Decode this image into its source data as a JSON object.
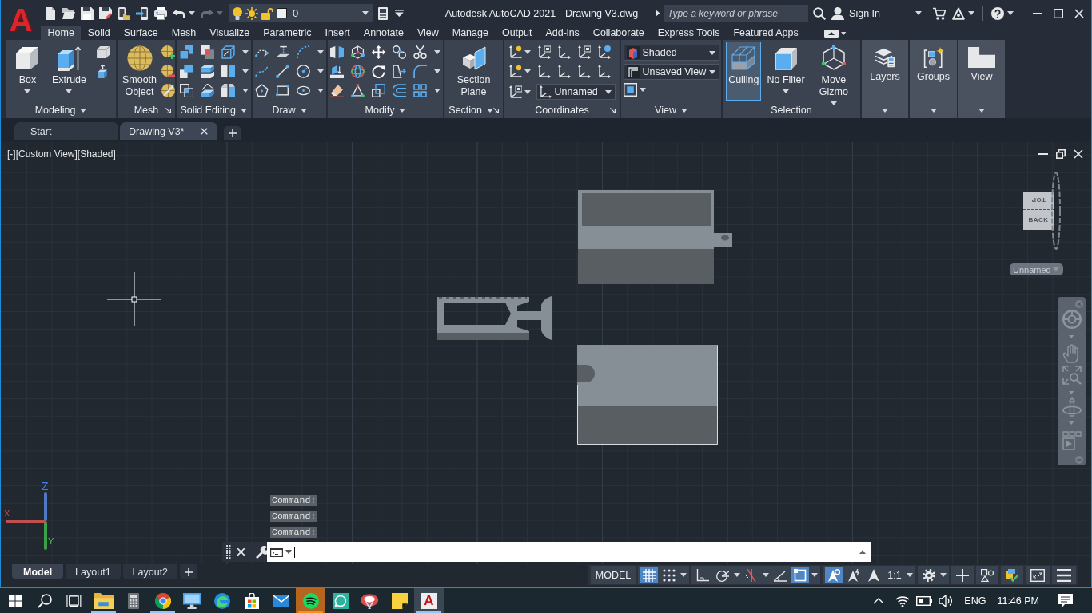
{
  "title_bar": {
    "logo": "A",
    "quick_access": [
      {
        "kind": "new",
        "disabled": false,
        "menu": false
      },
      {
        "kind": "open",
        "disabled": false,
        "menu": false
      },
      {
        "kind": "save",
        "disabled": false,
        "menu": false
      },
      {
        "kind": "save-as",
        "disabled": false,
        "menu": false
      },
      {
        "kind": "open-mobile",
        "disabled": false,
        "menu": false
      },
      {
        "kind": "share-mobile",
        "disabled": false,
        "menu": false
      },
      {
        "kind": "plot",
        "disabled": false,
        "menu": false
      },
      {
        "kind": "undo",
        "disabled": false,
        "menu": true
      },
      {
        "kind": "redo",
        "disabled": true,
        "menu": true
      }
    ],
    "layer": {
      "on": true,
      "frozen": false,
      "locked": false,
      "value": "0"
    },
    "app_title": "Autodesk AutoCAD 2021",
    "file_name": "Drawing V3.dwg",
    "search": {
      "placeholder": "Type a keyword or phrase"
    },
    "sign_in": "Sign In"
  },
  "ribbon": {
    "tabs": [
      {
        "label": "Home",
        "selected": true
      },
      {
        "label": "Solid",
        "selected": false
      },
      {
        "label": "Surface",
        "selected": false
      },
      {
        "label": "Mesh",
        "selected": false
      },
      {
        "label": "Visualize",
        "selected": false
      },
      {
        "label": "Parametric",
        "selected": false
      },
      {
        "label": "Insert",
        "selected": false
      },
      {
        "label": "Annotate",
        "selected": false
      },
      {
        "label": "View",
        "selected": false
      },
      {
        "label": "Manage",
        "selected": false
      },
      {
        "label": "Output",
        "selected": false
      },
      {
        "label": "Add-ins",
        "selected": false
      },
      {
        "label": "Collaborate",
        "selected": false
      },
      {
        "label": "Express Tools",
        "selected": false
      },
      {
        "label": "Featured Apps",
        "selected": false
      }
    ],
    "panels": [
      {
        "kind": "modeling",
        "label": "Modeling",
        "menu": true,
        "launcher": false,
        "buttons": [
          {
            "label": "Box",
            "menu": true
          },
          {
            "label": "Extrude",
            "menu": true
          }
        ]
      },
      {
        "kind": "mesh",
        "label": "Mesh",
        "menu": false,
        "launcher": true,
        "buttons": [
          {
            "label": "Smooth Object",
            "menu": false
          }
        ]
      },
      {
        "kind": "solid-editing",
        "label": "Solid Editing",
        "menu": true,
        "launcher": false
      },
      {
        "kind": "draw",
        "label": "Draw",
        "menu": true,
        "launcher": false
      },
      {
        "kind": "modify",
        "label": "Modify",
        "menu": true,
        "launcher": false
      },
      {
        "kind": "section",
        "label": "Section",
        "menu": true,
        "launcher": true,
        "buttons": [
          {
            "label": "Section Plane",
            "menu": false
          }
        ]
      },
      {
        "kind": "coordinates",
        "label": "Coordinates",
        "menu": false,
        "launcher": true,
        "dropdowns": [
          {
            "value": "Unnamed"
          }
        ]
      },
      {
        "kind": "view",
        "label": "View",
        "menu": true,
        "launcher": false,
        "dropdowns": [
          {
            "value": "Shaded"
          },
          {
            "value": "Unsaved View"
          }
        ]
      },
      {
        "kind": "selection",
        "label": "Selection",
        "menu": false,
        "launcher": false,
        "buttons": [
          {
            "label": "Culling",
            "menu": false,
            "on": true
          },
          {
            "label": "No Filter",
            "menu": true,
            "on": false
          },
          {
            "label": "Move Gizmo",
            "menu": true,
            "on": false
          }
        ]
      },
      {
        "kind": "layers",
        "label": "Layers",
        "menu": true
      },
      {
        "kind": "groups",
        "label": "Groups",
        "menu": true
      },
      {
        "kind": "views",
        "label": "View",
        "menu": true
      }
    ]
  },
  "file_tabs": [
    {
      "label": "Start",
      "selected": false
    },
    {
      "label": "Drawing V3*",
      "selected": true
    }
  ],
  "viewport": {
    "controls": [
      "[-]",
      "[Custom View]",
      "[Shaded]"
    ],
    "view_cube": {
      "top": "TOP",
      "side": "BACK"
    },
    "named_view": "Unnamed",
    "ucs": {
      "z": "Z",
      "x": "X",
      "y": "Y"
    },
    "command_history": [
      "Command:",
      "Command:",
      "Command:"
    ]
  },
  "layout_tabs": [
    {
      "label": "Model",
      "selected": true
    },
    {
      "label": "Layout1",
      "selected": false
    },
    {
      "label": "Layout2",
      "selected": false
    }
  ],
  "status_bar": {
    "groups": [
      [
        {
          "kind": "text",
          "label": "MODEL",
          "on": false,
          "menu": false
        }
      ],
      [
        {
          "kind": "grid",
          "on": true,
          "menu": false
        },
        {
          "kind": "snap",
          "on": false,
          "menu": true
        }
      ],
      [
        {
          "kind": "ortho",
          "on": false,
          "menu": false
        },
        {
          "kind": "polar",
          "on": false,
          "menu": true
        },
        {
          "kind": "isodraft",
          "on": false,
          "menu": true
        },
        {
          "kind": "angle",
          "on": false,
          "menu": false
        },
        {
          "kind": "osnap",
          "on": true,
          "menu": true
        }
      ],
      [
        {
          "kind": "annotation-visibility",
          "on": true,
          "menu": false
        },
        {
          "kind": "auto-scale",
          "on": false,
          "menu": false
        },
        {
          "kind": "annotation",
          "on": false,
          "menu": false
        },
        {
          "kind": "text",
          "label": "1:1",
          "on": false,
          "menu": true
        }
      ],
      [
        {
          "kind": "settings",
          "on": false,
          "menu": true
        }
      ],
      [
        {
          "kind": "plus",
          "on": false,
          "menu": false
        }
      ],
      [
        {
          "kind": "shapes",
          "on": false,
          "menu": false
        }
      ],
      [
        {
          "kind": "isolate",
          "on": false,
          "menu": false
        }
      ],
      [
        {
          "kind": "fullscreen",
          "on": false,
          "menu": false
        }
      ],
      [
        {
          "kind": "menu",
          "on": false,
          "menu": false
        }
      ]
    ]
  },
  "taskbar": {
    "apps": [
      {
        "kind": "folder",
        "running": true,
        "selected": false,
        "flashing": false
      },
      {
        "kind": "calculator",
        "running": false,
        "selected": false,
        "flashing": false
      },
      {
        "kind": "ring",
        "running": true,
        "selected": false,
        "flashing": false
      },
      {
        "kind": "monitor",
        "running": false,
        "selected": false,
        "flashing": false
      },
      {
        "kind": "swirl",
        "running": false,
        "selected": false,
        "flashing": false
      },
      {
        "kind": "bag",
        "running": false,
        "selected": false,
        "flashing": false
      },
      {
        "kind": "envelope",
        "running": false,
        "selected": false,
        "flashing": false
      },
      {
        "kind": "waves",
        "running": true,
        "selected": false,
        "flashing": true
      },
      {
        "kind": "chat",
        "running": false,
        "selected": false,
        "flashing": false
      },
      {
        "kind": "snip",
        "running": false,
        "selected": false,
        "flashing": false
      },
      {
        "kind": "note",
        "running": false,
        "selected": false,
        "flashing": false
      },
      {
        "kind": "letter",
        "glyph": "A",
        "running": true,
        "selected": true,
        "flashing": false
      }
    ],
    "tray": {
      "language": "ENG",
      "time": "11:46 PM"
    }
  }
}
